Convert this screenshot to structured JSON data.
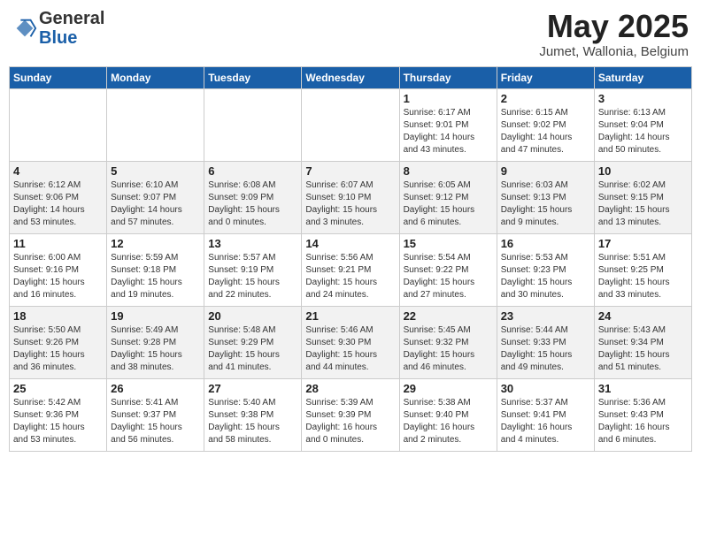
{
  "header": {
    "logo_line1": "General",
    "logo_line2": "Blue",
    "month_title": "May 2025",
    "location": "Jumet, Wallonia, Belgium"
  },
  "weekdays": [
    "Sunday",
    "Monday",
    "Tuesday",
    "Wednesday",
    "Thursday",
    "Friday",
    "Saturday"
  ],
  "weeks": [
    [
      {
        "day": "",
        "detail": ""
      },
      {
        "day": "",
        "detail": ""
      },
      {
        "day": "",
        "detail": ""
      },
      {
        "day": "",
        "detail": ""
      },
      {
        "day": "1",
        "detail": "Sunrise: 6:17 AM\nSunset: 9:01 PM\nDaylight: 14 hours\nand 43 minutes."
      },
      {
        "day": "2",
        "detail": "Sunrise: 6:15 AM\nSunset: 9:02 PM\nDaylight: 14 hours\nand 47 minutes."
      },
      {
        "day": "3",
        "detail": "Sunrise: 6:13 AM\nSunset: 9:04 PM\nDaylight: 14 hours\nand 50 minutes."
      }
    ],
    [
      {
        "day": "4",
        "detail": "Sunrise: 6:12 AM\nSunset: 9:06 PM\nDaylight: 14 hours\nand 53 minutes."
      },
      {
        "day": "5",
        "detail": "Sunrise: 6:10 AM\nSunset: 9:07 PM\nDaylight: 14 hours\nand 57 minutes."
      },
      {
        "day": "6",
        "detail": "Sunrise: 6:08 AM\nSunset: 9:09 PM\nDaylight: 15 hours\nand 0 minutes."
      },
      {
        "day": "7",
        "detail": "Sunrise: 6:07 AM\nSunset: 9:10 PM\nDaylight: 15 hours\nand 3 minutes."
      },
      {
        "day": "8",
        "detail": "Sunrise: 6:05 AM\nSunset: 9:12 PM\nDaylight: 15 hours\nand 6 minutes."
      },
      {
        "day": "9",
        "detail": "Sunrise: 6:03 AM\nSunset: 9:13 PM\nDaylight: 15 hours\nand 9 minutes."
      },
      {
        "day": "10",
        "detail": "Sunrise: 6:02 AM\nSunset: 9:15 PM\nDaylight: 15 hours\nand 13 minutes."
      }
    ],
    [
      {
        "day": "11",
        "detail": "Sunrise: 6:00 AM\nSunset: 9:16 PM\nDaylight: 15 hours\nand 16 minutes."
      },
      {
        "day": "12",
        "detail": "Sunrise: 5:59 AM\nSunset: 9:18 PM\nDaylight: 15 hours\nand 19 minutes."
      },
      {
        "day": "13",
        "detail": "Sunrise: 5:57 AM\nSunset: 9:19 PM\nDaylight: 15 hours\nand 22 minutes."
      },
      {
        "day": "14",
        "detail": "Sunrise: 5:56 AM\nSunset: 9:21 PM\nDaylight: 15 hours\nand 24 minutes."
      },
      {
        "day": "15",
        "detail": "Sunrise: 5:54 AM\nSunset: 9:22 PM\nDaylight: 15 hours\nand 27 minutes."
      },
      {
        "day": "16",
        "detail": "Sunrise: 5:53 AM\nSunset: 9:23 PM\nDaylight: 15 hours\nand 30 minutes."
      },
      {
        "day": "17",
        "detail": "Sunrise: 5:51 AM\nSunset: 9:25 PM\nDaylight: 15 hours\nand 33 minutes."
      }
    ],
    [
      {
        "day": "18",
        "detail": "Sunrise: 5:50 AM\nSunset: 9:26 PM\nDaylight: 15 hours\nand 36 minutes."
      },
      {
        "day": "19",
        "detail": "Sunrise: 5:49 AM\nSunset: 9:28 PM\nDaylight: 15 hours\nand 38 minutes."
      },
      {
        "day": "20",
        "detail": "Sunrise: 5:48 AM\nSunset: 9:29 PM\nDaylight: 15 hours\nand 41 minutes."
      },
      {
        "day": "21",
        "detail": "Sunrise: 5:46 AM\nSunset: 9:30 PM\nDaylight: 15 hours\nand 44 minutes."
      },
      {
        "day": "22",
        "detail": "Sunrise: 5:45 AM\nSunset: 9:32 PM\nDaylight: 15 hours\nand 46 minutes."
      },
      {
        "day": "23",
        "detail": "Sunrise: 5:44 AM\nSunset: 9:33 PM\nDaylight: 15 hours\nand 49 minutes."
      },
      {
        "day": "24",
        "detail": "Sunrise: 5:43 AM\nSunset: 9:34 PM\nDaylight: 15 hours\nand 51 minutes."
      }
    ],
    [
      {
        "day": "25",
        "detail": "Sunrise: 5:42 AM\nSunset: 9:36 PM\nDaylight: 15 hours\nand 53 minutes."
      },
      {
        "day": "26",
        "detail": "Sunrise: 5:41 AM\nSunset: 9:37 PM\nDaylight: 15 hours\nand 56 minutes."
      },
      {
        "day": "27",
        "detail": "Sunrise: 5:40 AM\nSunset: 9:38 PM\nDaylight: 15 hours\nand 58 minutes."
      },
      {
        "day": "28",
        "detail": "Sunrise: 5:39 AM\nSunset: 9:39 PM\nDaylight: 16 hours\nand 0 minutes."
      },
      {
        "day": "29",
        "detail": "Sunrise: 5:38 AM\nSunset: 9:40 PM\nDaylight: 16 hours\nand 2 minutes."
      },
      {
        "day": "30",
        "detail": "Sunrise: 5:37 AM\nSunset: 9:41 PM\nDaylight: 16 hours\nand 4 minutes."
      },
      {
        "day": "31",
        "detail": "Sunrise: 5:36 AM\nSunset: 9:43 PM\nDaylight: 16 hours\nand 6 minutes."
      }
    ]
  ]
}
